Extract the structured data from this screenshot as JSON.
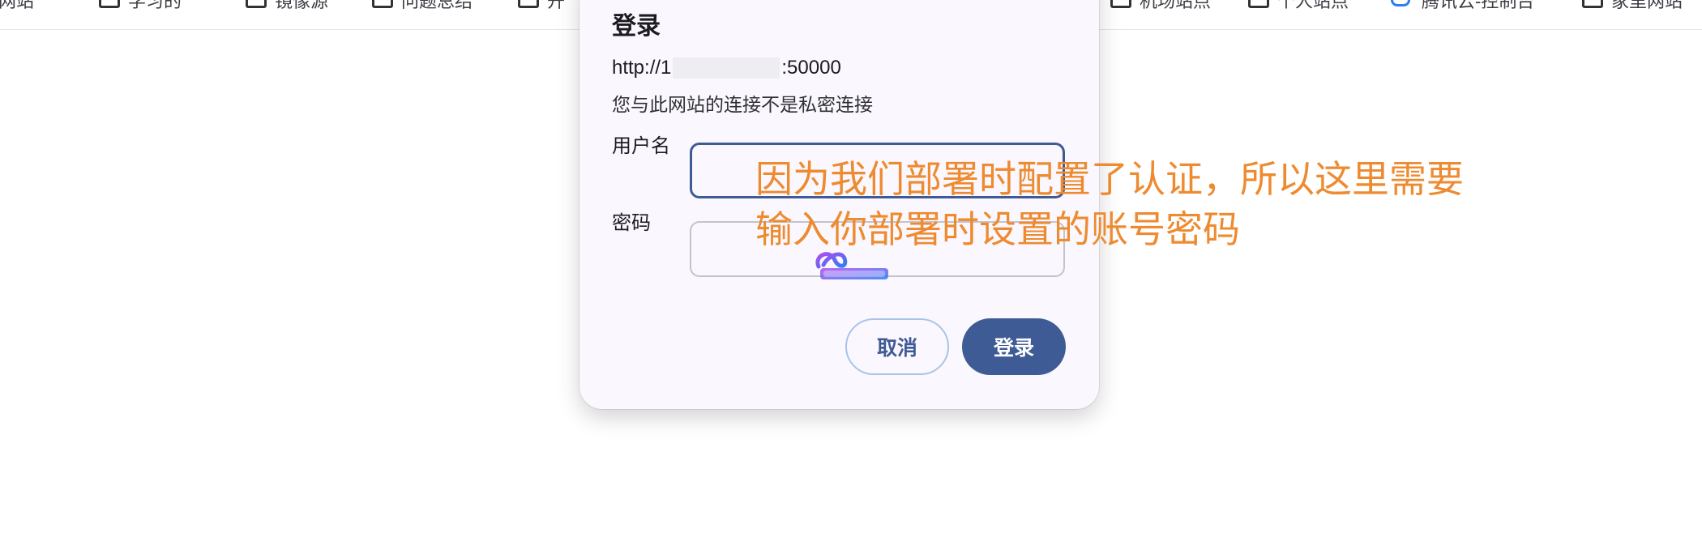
{
  "bookmarks": [
    {
      "label": "网站",
      "icon": "folder-icon"
    },
    {
      "label": "学习的",
      "icon": "folder-icon"
    },
    {
      "label": "镜像源",
      "icon": "folder-icon"
    },
    {
      "label": "问题总结",
      "icon": "folder-icon"
    },
    {
      "label": "开",
      "icon": "folder-icon"
    },
    {
      "label": "机场站点",
      "icon": "folder-icon"
    },
    {
      "label": "个人站点",
      "icon": "folder-icon"
    },
    {
      "label": "腾讯云-控制台",
      "icon": "cloud-icon"
    },
    {
      "label": "家里网站",
      "icon": "folder-icon"
    }
  ],
  "dialog": {
    "title": "登录",
    "url_prefix": "http://1",
    "url_suffix": ":50000",
    "privacy_note": "您与此网站的连接不是私密连接",
    "username_label": "用户名",
    "username_value": "",
    "password_label": "密码",
    "password_value": "",
    "cancel_label": "取消",
    "login_label": "登录"
  },
  "annotation": {
    "line1": "因为我们部署时配置了认证，所以这里需要",
    "line2": "输入你部署时设置的账号密码",
    "color": "#ee8a2f"
  },
  "colors": {
    "primary": "#3f5b95",
    "dialog_bg": "#faf8fe",
    "cancel_border": "#a9c3e6"
  }
}
